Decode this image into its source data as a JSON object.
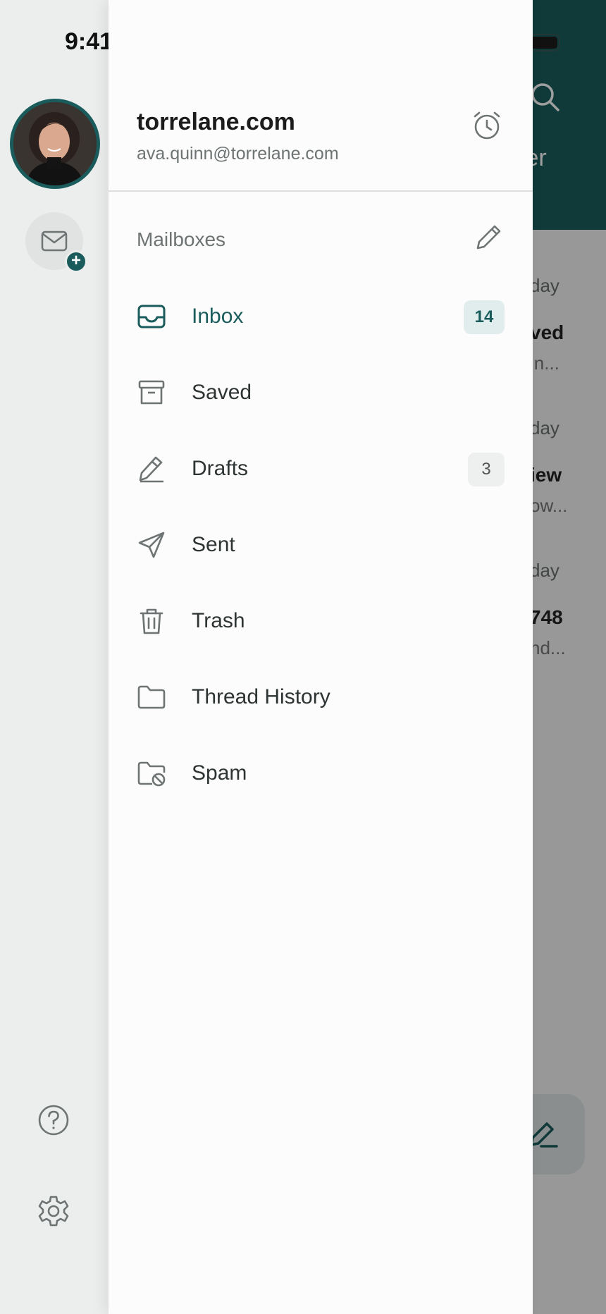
{
  "status_bar": {
    "time": "9:41"
  },
  "background": {
    "filter_fragment": "ter",
    "rows": [
      {
        "day": "day",
        "title": "ved",
        "sub": "in..."
      },
      {
        "day": "day",
        "title": "iew",
        "sub": "ow..."
      },
      {
        "day": "day",
        "title": "748",
        "sub": "nd..."
      }
    ]
  },
  "account": {
    "domain": "torrelane.com",
    "email": "ava.quinn@torrelane.com"
  },
  "mailboxes": {
    "section_label": "Mailboxes",
    "items": [
      {
        "label": "Inbox",
        "icon": "inbox-icon",
        "badge": "14",
        "active": true
      },
      {
        "label": "Saved",
        "icon": "archive-icon"
      },
      {
        "label": "Drafts",
        "icon": "pencil-icon",
        "badge": "3"
      },
      {
        "label": "Sent",
        "icon": "send-icon"
      },
      {
        "label": "Trash",
        "icon": "trash-icon"
      },
      {
        "label": "Thread History",
        "icon": "folder-icon"
      },
      {
        "label": "Spam",
        "icon": "folder-block-icon"
      }
    ]
  },
  "add_account_badge": "+",
  "colors": {
    "accent": "#1a5c5c",
    "text": "#2e3333",
    "muted": "#6e7373"
  }
}
